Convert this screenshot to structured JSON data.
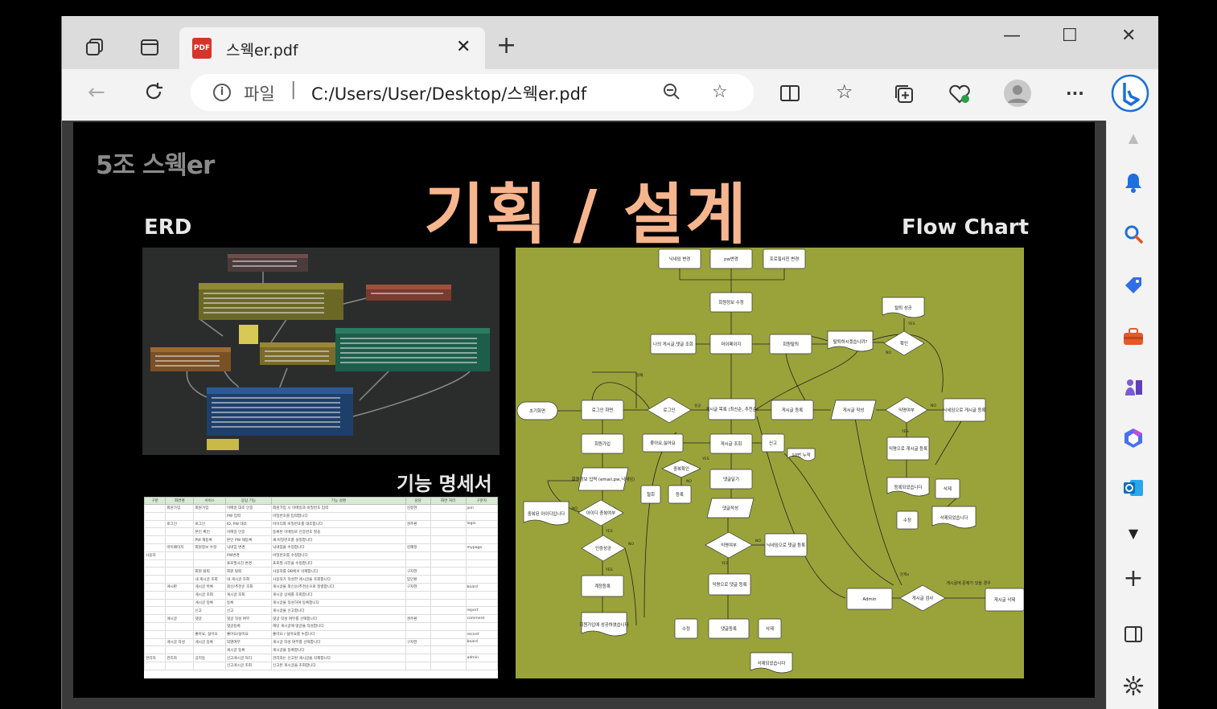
{
  "browser": {
    "tab_title": "스웩er.pdf",
    "pdf_badge": "PDF",
    "new_tab_label": "+",
    "address_label": "파일",
    "address_url": "C:/Users/User/Desktop/스웩er.pdf",
    "info_icon": "i",
    "more_label": "···"
  },
  "slide": {
    "team_name": "5조 스웩er",
    "title": "기획 / 설계",
    "erd_label": "ERD",
    "flow_label": "Flow Chart",
    "spec_label": "기능 명세서"
  },
  "flowchart": {
    "nodes": {
      "nickname_change": "닉네임 변경",
      "pw_change": "pw변경",
      "profile_change": "프로필사진 변경",
      "edit_info": "회원정보 수정",
      "withdraw_success": "탈퇴 성공",
      "mypage": "마이페이지",
      "my_posts": "나의 게시글,댓글 조회",
      "withdraw": "회원탈퇴",
      "withdraw_confirm": "탈퇴하시겠습니까?",
      "confirm": "확인",
      "home": "초기화면",
      "login": "로그인 화면",
      "login_dec": "로그인",
      "post_list": "게시글 목록 (최신순, 추천순)",
      "post_register": "게시글 등록",
      "post_write": "게시글 작성",
      "anon": "익명여부",
      "nick_post": "닉네임으로 게시글 등록",
      "signup": "회원가입",
      "like": "좋아요,싫어요",
      "post_view": "게시글 조회",
      "report": "신고",
      "report_acc": "10번 누적",
      "anon_post": "익명으로 게시글 등록",
      "registered": "등록되었습니다",
      "delete": "삭제",
      "edit": "수정",
      "deleted": "삭제되었습니다",
      "dup_check": "중복확인",
      "cancel": "철회",
      "reg": "등록",
      "comment_view": "댓글달기",
      "signup_input": "회원정보 입력 (email,pw,닉네임)",
      "id_used": "중복된 아이디입니다",
      "id_check": "아이디 중복여부",
      "comment_write": "댓글작성",
      "auth_ok": "인증성공",
      "comment_anon": "익명여부",
      "nick_comment": "닉네임으로 댓글 등록",
      "signup_done": "계정등록",
      "anon_comment": "익명으로 댓글 등록",
      "admin": "Admin",
      "post_check": "게시글 검사",
      "post_delete": "게시글 삭제",
      "problem": "게시글에 문제가 있을 경우",
      "signup_success": "회원가입에 성공하였습니다",
      "edit2": "수정",
      "comment_reg": "댓글등록",
      "delete2": "삭제",
      "deleted2": "삭제되었습니다",
      "fail": "실패",
      "pass": "성공",
      "yes": "YES",
      "no": "NO",
      "reported": "문제x"
    }
  },
  "spec": {
    "headers": [
      "구분",
      "화면명",
      "서비스",
      "응답 기능",
      "기능 설명",
      "담당",
      "화면 처리",
      "구분자"
    ],
    "rows": [
      [
        "",
        "회원가입",
        "회원가입",
        "이메일 대조 인증",
        "회원가입 시 이메일과 비밀번호 입력",
        "김정현",
        "join"
      ],
      [
        "",
        "",
        "",
        "PW 입력",
        "비밀번호를 입력합니다",
        "",
        ""
      ],
      [
        "",
        "로그인",
        "로그인",
        "ID, PW 대조",
        "아이디와 비밀번호를 대조합니다",
        "권주환",
        "login"
      ],
      [
        "",
        "",
        "본인 확인",
        "이메일 인증",
        "등록된 이메일로 인증번호 발송",
        "",
        ""
      ],
      [
        "",
        "",
        "PW 재등록",
        "본인 PW 재등록",
        "새 비밀번호를 설정합니다",
        "",
        ""
      ],
      [
        "",
        "마이페이지",
        "회원정보 수정",
        "닉네임 변경",
        "닉네임을 수정합니다",
        "김혜정",
        "mypage"
      ],
      [
        "사용자",
        "",
        "",
        "PW변경",
        "비밀번호를 수정합니다",
        "",
        ""
      ],
      [
        "",
        "",
        "",
        "프로필사진 변경",
        "프로필 사진을 수정합니다",
        "",
        ""
      ],
      [
        "",
        "",
        "회원 탈퇴",
        "회원 탈퇴",
        "사용자를 DB에서 삭제합니다",
        "구자현",
        ""
      ],
      [
        "",
        "",
        "내 게시글 조회",
        "내 게시글 조회",
        "사용자가 작성한 게시글을 조회합니다",
        "임인환",
        ""
      ],
      [
        "",
        "게시판",
        "게시글 목록",
        "최신/추천순 조회",
        "게시글을 최신순/추천순으로 정렬합니다",
        "구자현",
        "board"
      ],
      [
        "",
        "",
        "게시글 조회",
        "게시글 조회",
        "게시글 상세를 조회합니다",
        "",
        ""
      ],
      [
        "",
        "",
        "게시글 등록",
        "등록",
        "게시글을 작성하여 등록합니다",
        "",
        ""
      ],
      [
        "",
        "",
        "신고",
        "신고",
        "게시글을 신고합니다",
        "",
        "report"
      ],
      [
        "",
        "게시글",
        "댓글",
        "댓글 작성 여부",
        "댓글 작성 여부를 선택합니다",
        "권주환",
        "comment"
      ],
      [
        "",
        "",
        "",
        "댓글등록",
        "해당 게시글에 댓글을 작성합니다",
        "",
        ""
      ],
      [
        "",
        "",
        "좋아요, 싫어요",
        "좋아요/싫어요",
        "좋아요 / 싫어요를 누릅니다",
        "",
        "record"
      ],
      [
        "",
        "게시글 작성",
        "게시글 등록",
        "익명여부",
        "게시글 작성 여부를 선택합니다",
        "구자현",
        "board"
      ],
      [
        "",
        "",
        "",
        "게시글 등록",
        "게시글을 등록합니다",
        "",
        ""
      ],
      [
        "관리자",
        "관리자",
        "공지등",
        "신고게시글 처리",
        "관리자는 신고된 게시글을 삭제합니다",
        "",
        "admin"
      ],
      [
        "",
        "",
        "",
        "신고게시글 조회",
        "신고된 게시글을 조회합니다",
        "",
        ""
      ]
    ]
  },
  "erd": {
    "tables": [
      "comment",
      "member",
      "board",
      "file",
      "like_record",
      "report",
      "admin"
    ]
  },
  "icons": {
    "tab_actions": "tab-actions-icon",
    "workspaces": "workspaces-icon",
    "back": "back-arrow-icon",
    "refresh": "refresh-icon",
    "zoom": "zoom-out-icon",
    "favorite": "star-icon",
    "split": "split-screen-icon",
    "favorites": "favorites-icon",
    "collections": "collections-icon",
    "health": "browser-essentials-icon",
    "profile": "profile-avatar-icon",
    "copilot": "bing-copilot-icon"
  },
  "colors": {
    "title_color": "#f7b58e",
    "flow_bg": "#9aa33a",
    "erd_bg": "#2b2d2c"
  }
}
